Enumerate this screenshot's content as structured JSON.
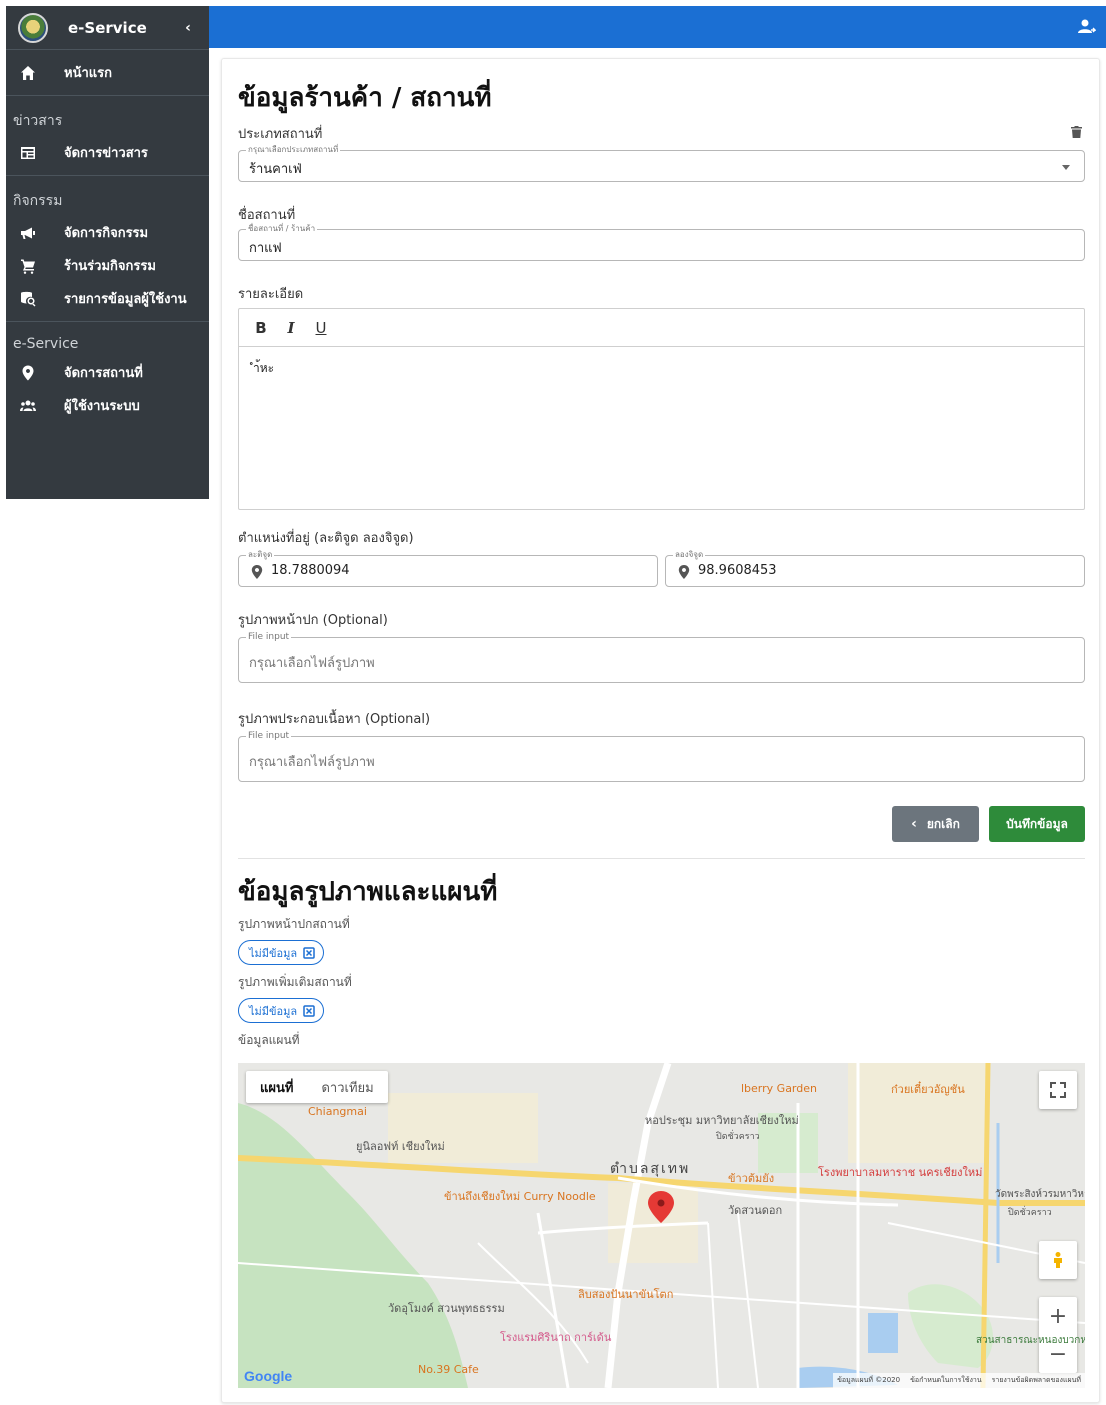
{
  "sidebar": {
    "brand": "e-Service",
    "home": "หน้าแรก",
    "groups": [
      {
        "header": "ข่าวสาร",
        "items": [
          "จัดการข่าวสาร"
        ]
      },
      {
        "header": "กิจกรรม",
        "items": [
          "จัดการกิจกรรม",
          "ร้านร่วมกิจกรรม",
          "รายการข้อมูลผู้ใช้งาน"
        ]
      },
      {
        "header": "e-Service",
        "items": [
          "จัดการสถานที่",
          "ผู้ใช้งานระบบ"
        ]
      }
    ]
  },
  "form": {
    "title": "ข้อมูลร้านค้า / สถานที่",
    "type_label": "ประเภทสถานที่",
    "type_legend": "กรุณาเลือกประเภทสถานที่",
    "type_value": "ร้านคาเฟ่",
    "name_label": "ชื่อสถานที่",
    "name_legend": "ชื่อสถานที่ / ร้านค้า",
    "name_value": "กาแฟ",
    "detail_label": "รายละเอียด",
    "toolbar": {
      "bold": "B",
      "italic": "I",
      "underline": "U"
    },
    "detail_value": "ำ้หะ",
    "location_label": "ตำแหน่งที่อยู่ (ละติจูด ลองจิจูด)",
    "lat_legend": "ละติจูด",
    "lat_value": "18.7880094",
    "lng_legend": "ลองจิจูด",
    "lng_value": "98.9608453",
    "cover_label": "รูปภาพหน้าปก (Optional)",
    "cover_legend": "File input",
    "cover_placeholder": "กรุณาเลือกไฟล์รูปภาพ",
    "content_label": "รูปภาพประกอบเนื้อหา (Optional)",
    "content_legend": "File input",
    "content_placeholder": "กรุณาเลือกไฟล์รูปภาพ",
    "cancel_label": "ยกเลิก",
    "save_label": "บันทึกข้อมูล"
  },
  "media": {
    "title": "ข้อมูลรูปภาพและแผนที่",
    "cover_label": "รูปภาพหน้าปกสถานที่",
    "cover_chip": "ไม่มีข้อมูล",
    "extra_label": "รูปภาพเพิ่มเติมสถานที่",
    "extra_chip": "ไม่มีข้อมูล",
    "map_label": "ข้อมูลแผนที่"
  },
  "map": {
    "tabs": [
      "แผนที่",
      "ดาวเทียม"
    ],
    "labels": {
      "chiangmai": "Chiangmai",
      "berry": "lberry Garden",
      "noodle_shop": "ก๋วยเตี๋ยวอัญชัน",
      "hall": "หอประชุม มหาวิทยาลัยเชียงใหม่",
      "hall_sub": "ปิดชั่วคราว",
      "unilov": "ยูนิลอฟท์ เชียงใหม่",
      "subdistrict": "ตำบลสุเทพ",
      "khaomanyang": "ข้าวต้มยัง",
      "hospital": "โรงพยาบาลมหาราช นครเชียงใหม่",
      "curry": "ข้านถึงเชียงใหม่ Curry Noodle",
      "suandok": "วัดสวนดอก",
      "phrasing": "วัดพระสิงห์วรมหาวิหาร",
      "phrasing_sub": "ปิดชั่วคราว",
      "umong": "วัดอุโมงค์ สวนพุทธธรรม",
      "kanom": "ลิบสองปันนาขันโตก",
      "hotel": "โรงแรมศิรินาถ การ์เด้น",
      "cafe": "No.39 Cafe",
      "park": "สวนสาธารณะหนองบวกหาด",
      "google": "Google",
      "attr_data": "ข้อมูลแผนที่ ©2020",
      "attr_terms": "ข้อกำหนดในการใช้งาน",
      "attr_report": "รายงานข้อผิดพลาดของแผนที่"
    }
  }
}
